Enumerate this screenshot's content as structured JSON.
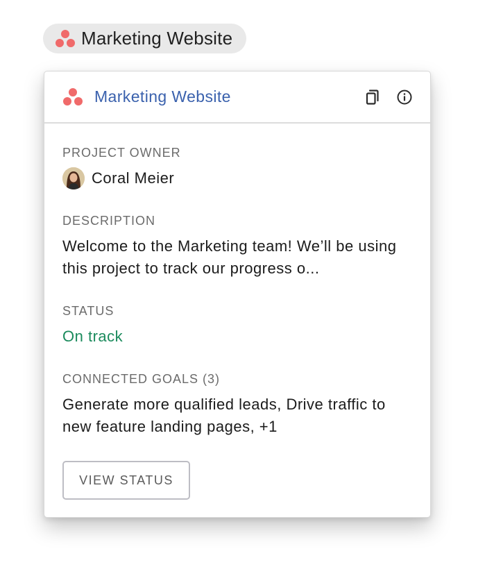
{
  "chip": {
    "label": "Marketing Website",
    "logo_icon": "asana-logo-icon"
  },
  "card": {
    "title": "Marketing Website",
    "logo_icon": "asana-logo-icon",
    "actions": {
      "copy_icon": "copy-icon",
      "info_icon": "info-icon"
    },
    "owner": {
      "label": "PROJECT OWNER",
      "name": "Coral Meier"
    },
    "description": {
      "label": "DESCRIPTION",
      "text": "Welcome to the Marketing team! We’ll be using this project to track our progress o..."
    },
    "status": {
      "label": "STATUS",
      "value": "On track",
      "color": "#1a8a5c"
    },
    "goals": {
      "label": "CONNECTED GOALS (3)",
      "text": "Generate more qualified leads, Drive traffic to new feature landing pages, +1"
    },
    "view_button_label": "VIEW STATUS"
  },
  "colors": {
    "brand_logo": "#f06a6a",
    "title_link": "#3a61ad",
    "chip_bg": "#e9e9e9"
  }
}
